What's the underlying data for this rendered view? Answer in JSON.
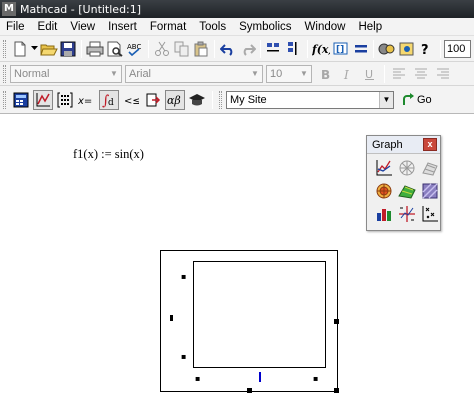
{
  "window": {
    "title": "Mathcad - [Untitled:1]",
    "app_letter": "M"
  },
  "menu": [
    "File",
    "Edit",
    "View",
    "Insert",
    "Format",
    "Tools",
    "Symbolics",
    "Window",
    "Help"
  ],
  "toolbar_format": {
    "style_value": "Normal",
    "font_value": "Arial",
    "size_value": "10",
    "zoom_fragment": "100"
  },
  "toolbar_resources": {
    "site_value": "My Site",
    "go_label": "Go"
  },
  "worksheet": {
    "expression": "f1(x) := sin(x)"
  },
  "graph_palette": {
    "title": "Graph",
    "close_glyph": "x",
    "tools": [
      "xy-plot-icon",
      "polar-plot-icon",
      "surface-plot-icon",
      "contour-plot-icon",
      "3d-scatter-icon",
      "3d-bar-icon",
      "vector-field-icon",
      "zoom-icon",
      "trace-icon"
    ]
  },
  "plot": {
    "placeholder_glyph": "▪"
  },
  "colors": {
    "titlebar": "#1e2226",
    "toolbar_bg": "#f3f3f3",
    "accent_blue": "#0000cc"
  }
}
